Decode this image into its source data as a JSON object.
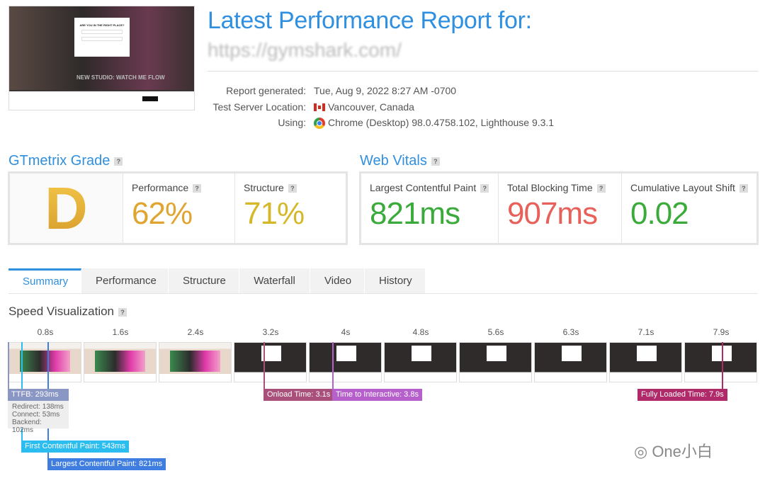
{
  "header": {
    "title": "Latest Performance Report for:",
    "url": "https://gymshark.com/",
    "rows": [
      {
        "label": "Report generated:",
        "value": "Tue, Aug 9, 2022 8:27 AM -0700"
      },
      {
        "label": "Test Server Location:",
        "value": "Vancouver, Canada",
        "icon": "canada-flag-icon"
      },
      {
        "label": "Using:",
        "value": "Chrome (Desktop) 98.0.4758.102, Lighthouse 9.3.1",
        "icon": "chrome-icon"
      }
    ]
  },
  "screenshot": {
    "modal_title": "ARE YOU IN THE RIGHT PLACE?",
    "hero_text": "NEW STUDIO: WATCH ME FLOW"
  },
  "grade": {
    "title": "GTmetrix Grade",
    "letter": "D",
    "performance_label": "Performance",
    "performance": "62%",
    "structure_label": "Structure",
    "structure": "71%",
    "colors": {
      "grade": "#e0a530",
      "performance": "#e0a530",
      "structure": "#d4b82a"
    }
  },
  "vitals": {
    "title": "Web Vitals",
    "items": [
      {
        "label": "Largest Contentful Paint",
        "value": "821ms",
        "color": "#3aab3a"
      },
      {
        "label": "Total Blocking Time",
        "value": "907ms",
        "color": "#e8605a"
      },
      {
        "label": "Cumulative Layout Shift",
        "value": "0.02",
        "color": "#3aab3a"
      }
    ]
  },
  "tabs": [
    "Summary",
    "Performance",
    "Structure",
    "Waterfall",
    "Video",
    "History"
  ],
  "active_tab": "Summary",
  "speed": {
    "title": "Speed Visualization",
    "times": [
      "0.8s",
      "1.6s",
      "2.4s",
      "3.2s",
      "4s",
      "4.8s",
      "5.6s",
      "6.3s",
      "7.1s",
      "7.9s"
    ],
    "ttfb": "TTFB: 293ms",
    "redirect": "Redirect: 138ms",
    "connect": "Connect: 53ms",
    "backend": "Backend: 102ms",
    "fcp": "First Contentful Paint: 543ms",
    "lcp": "Largest Contentful Paint: 821ms",
    "onload": "Onload Time: 3.1s",
    "tti": "Time to Interactive: 3.8s",
    "fully_loaded": "Fully Loaded Time: 7.9s"
  },
  "watermark": "One小白"
}
